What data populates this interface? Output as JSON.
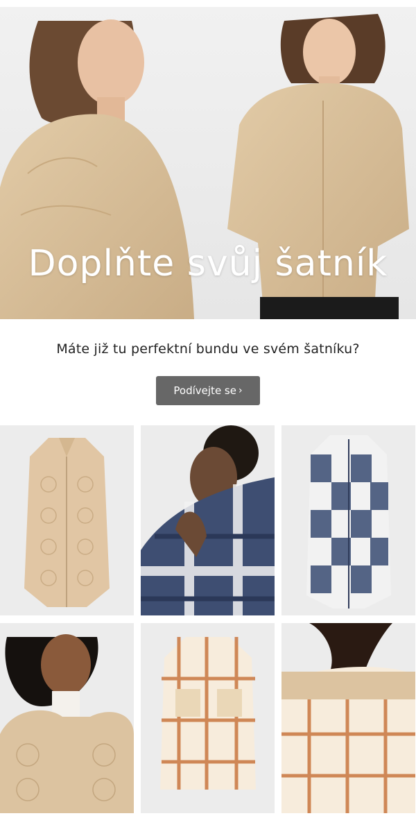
{
  "hero": {
    "title": "Doplňte svůj šatník",
    "image_alt": "two-models-quilted-beige-jackets"
  },
  "intro": {
    "text": "Máte již tu perfektní bundu ve svém šatníku?",
    "cta_label": "Podívejte se",
    "cta_chevron": "›"
  },
  "products": [
    {
      "name": "beige-quilted-long-coat"
    },
    {
      "name": "model-navy-check-shirt-jacket"
    },
    {
      "name": "navy-check-long-shirt-coat"
    },
    {
      "name": "model-beige-quilted-jacket"
    },
    {
      "name": "cream-rust-check-shirt-jacket"
    },
    {
      "name": "model-back-cream-check-jacket"
    }
  ],
  "colors": {
    "beige": "#dcc3a0",
    "navy": "#3e4e72",
    "rust": "#c9763f",
    "cta_bg": "#676767"
  }
}
